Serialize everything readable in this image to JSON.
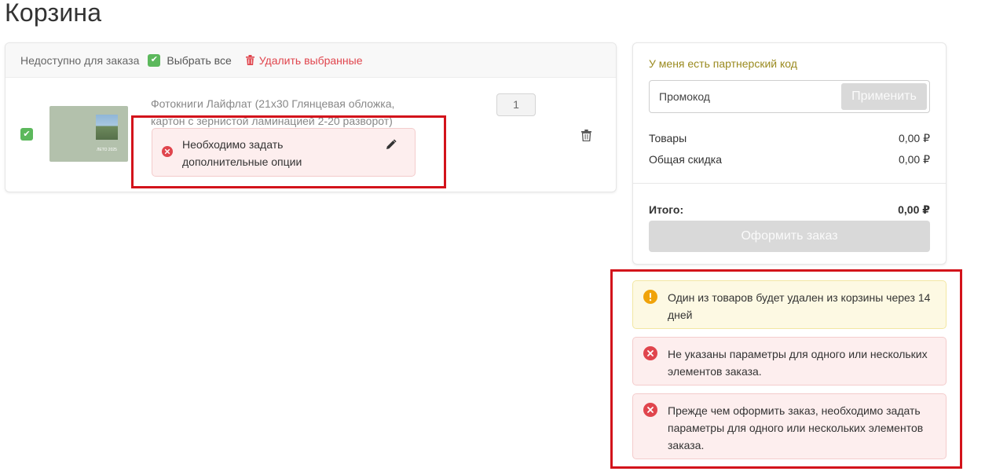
{
  "page": {
    "title": "Корзина"
  },
  "cart": {
    "toolbar": {
      "unavailable_label": "Недоступно для заказа",
      "select_all_label": "Выбрать все",
      "delete_selected_label": "Удалить выбранные"
    },
    "item": {
      "thumbnail_text": "ЛЕТО 2025",
      "title_line1": "Фотокниги Лайфлат (21x30 Глянцевая обложка,",
      "title_line2": "картон с зернистой ламинацией 2-20 разворот)",
      "quantity": "1",
      "error_line1": "Необходимо задать",
      "error_line2": "дополнительные опции"
    }
  },
  "summary": {
    "partner_code_label": "У меня есть партнерский код",
    "promo_placeholder": "Промокод",
    "apply_label": "Применить",
    "goods_label": "Товары",
    "goods_value": "0,00 ₽",
    "discount_label": "Общая скидка",
    "discount_value": "0,00 ₽",
    "total_label": "Итого:",
    "total_value": "0,00 ₽",
    "checkout_label": "Оформить заказ"
  },
  "alerts": {
    "warning_line1": "Один из товаров будет удален из корзины через 14",
    "warning_line2": "дней",
    "error1_line1": "Не указаны параметры для одного или нескольких",
    "error1_line2": "элементов заказа.",
    "error2_line1": "Прежде чем оформить заказ, необходимо задать",
    "error2_line2": "параметры для одного или нескольких элементов",
    "error2_line3": "заказа."
  },
  "colors": {
    "accent_green": "#5cb85c",
    "danger_red": "#e0454d",
    "partner_link": "#9a8a1f",
    "warning_icon": "#f0a30a",
    "highlight_box": "#d3131b"
  }
}
